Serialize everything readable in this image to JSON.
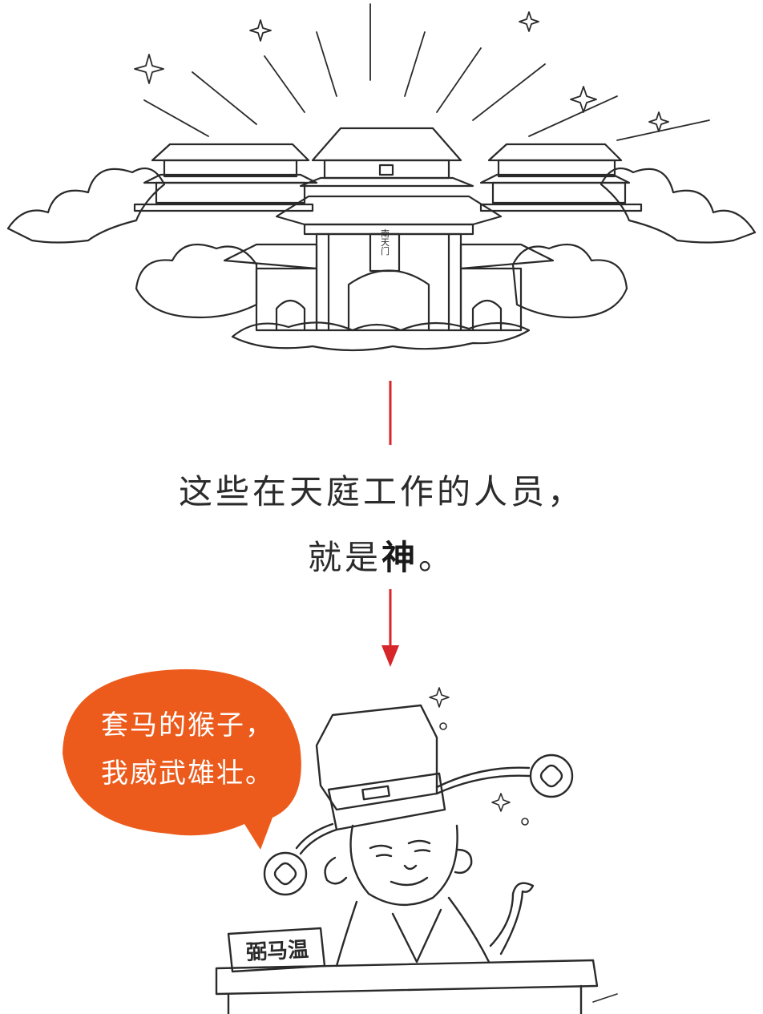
{
  "gate_plaque": "南天门",
  "caption": {
    "line1": "这些在天庭工作的人员，",
    "line2_prefix": "就是",
    "line2_emphasis": "神",
    "line2_suffix": "。"
  },
  "speech_bubble": {
    "line1": "套马的猴子，",
    "line2": "我威武雄壮。",
    "color": "#ec5b1c"
  },
  "desk_sign": "弼马温",
  "arrow_color": "#d6262a"
}
